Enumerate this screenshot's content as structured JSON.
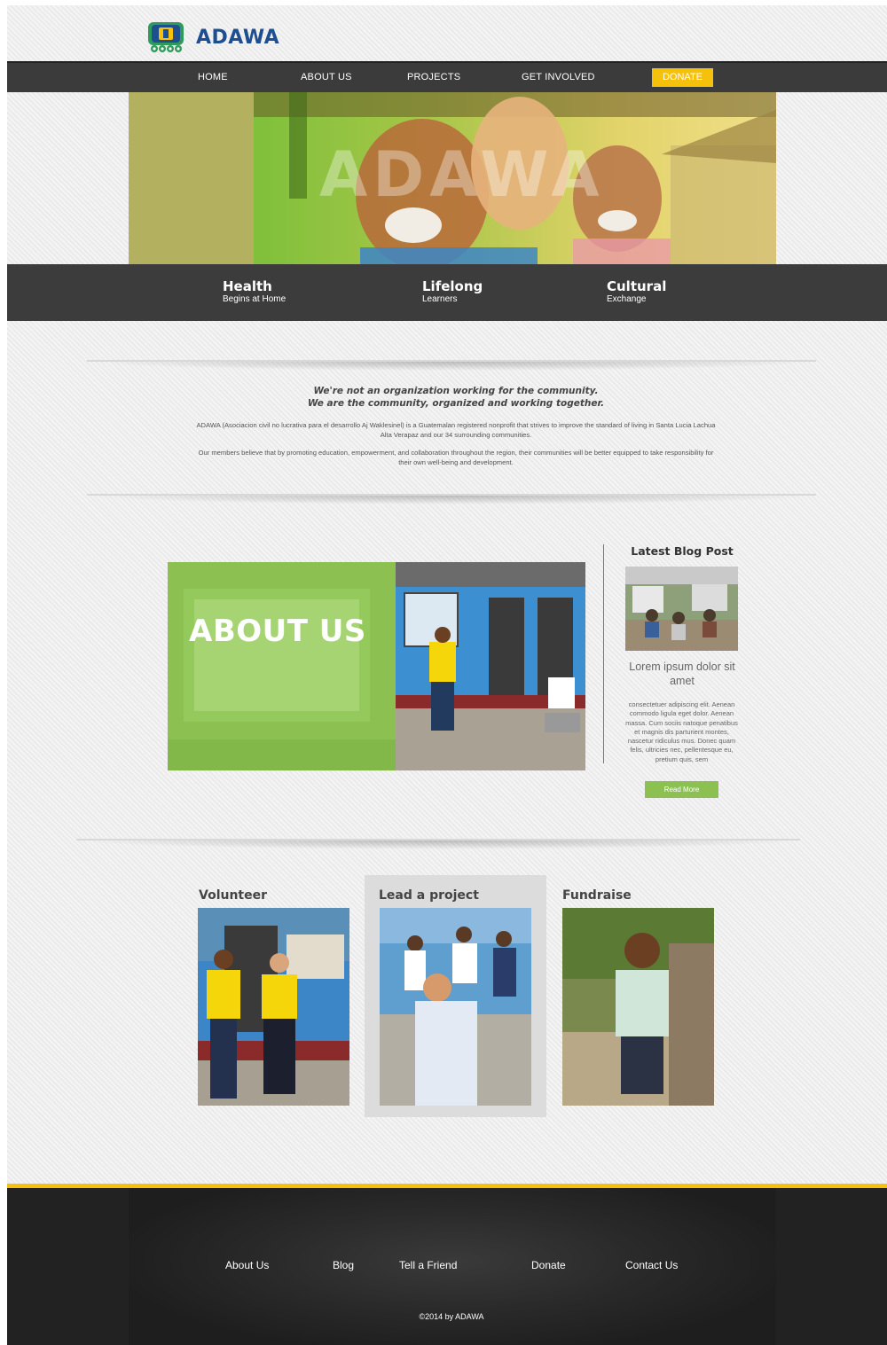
{
  "brand": {
    "name": "ADAWA",
    "primary_color": "#1d4e8f",
    "accent_yellow": "#f6c10b",
    "accent_green": "#8cc152"
  },
  "nav": {
    "items": [
      "HOME",
      "ABOUT US",
      "PROJECTS",
      "GET INVOLVED"
    ],
    "donate_label": "DONATE"
  },
  "hero": {
    "overlay_text": "ADAWA",
    "pillars": [
      {
        "title": "Health",
        "subtitle": "Begins at Home"
      },
      {
        "title": "Lifelong",
        "subtitle": "Learners"
      },
      {
        "title": "Cultural",
        "subtitle": "Exchange"
      }
    ]
  },
  "mission": {
    "headline_1": "We're not an organization working for the community.",
    "headline_2": "We are the community, organized and working together.",
    "paragraph_1": "ADAWA (Asociacion civil no lucrativa para el desarrollo Aj Waklesinel) is a Guatemalan registered nonprofit that strives to improve the standard of living in Santa Lucia Lachua Alta Verapaz and our 34 surrounding communities.",
    "paragraph_2": "Our members believe that by promoting education, empowerment, and collaboration throughout the region, their communities will be better equipped to take responsibility for their own well-being and development."
  },
  "about": {
    "title": "ABOUT US"
  },
  "blog": {
    "heading": "Latest Blog Post",
    "post_title": "Lorem ipsum dolor sit amet",
    "excerpt": "consectetuer adipiscing elit. Aenean commodo ligula eget dolor. Aenean massa. Cum sociis natoque penatibus et magnis dis parturient montes, nascetur ridiculus mus. Donec quam felis, ultricies nec, pellentesque eu, pretium quis, sem",
    "read_more": "Read More"
  },
  "involve": {
    "cards": [
      {
        "title": "Volunteer"
      },
      {
        "title": "Lead a project"
      },
      {
        "title": "Fundraise"
      }
    ]
  },
  "footer": {
    "links": [
      "About Us",
      "Blog",
      "Tell a Friend",
      "Donate",
      "Contact Us"
    ],
    "copyright": "©2014 by ADAWA"
  }
}
